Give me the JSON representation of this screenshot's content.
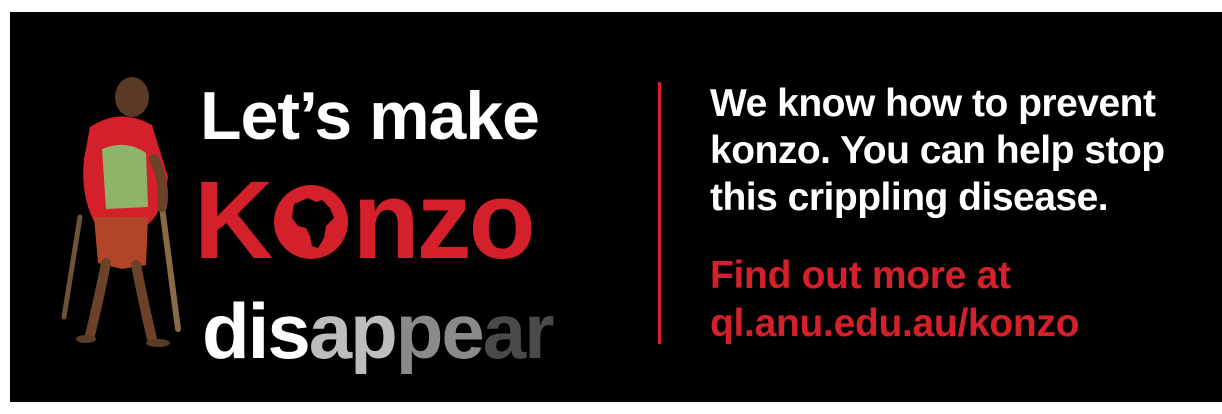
{
  "headline": {
    "line1": "Let’s make",
    "line2_prefix": "K",
    "line2_suffix": "nzo",
    "line3_parts": [
      "dis",
      "ap",
      "pe",
      "ar"
    ]
  },
  "message": {
    "lines": [
      "We know how to prevent",
      "konzo. You can help stop",
      "this crippling disease."
    ]
  },
  "cta": {
    "lines": [
      "Find out more at",
      "ql.anu.edu.au/konzo"
    ]
  },
  "colors": {
    "background": "#000000",
    "accent_red": "#d4202a",
    "text": "#ffffff"
  },
  "icons": {
    "o_glyph": "africa-map-icon",
    "photo": "child-with-crutches-illustration"
  }
}
